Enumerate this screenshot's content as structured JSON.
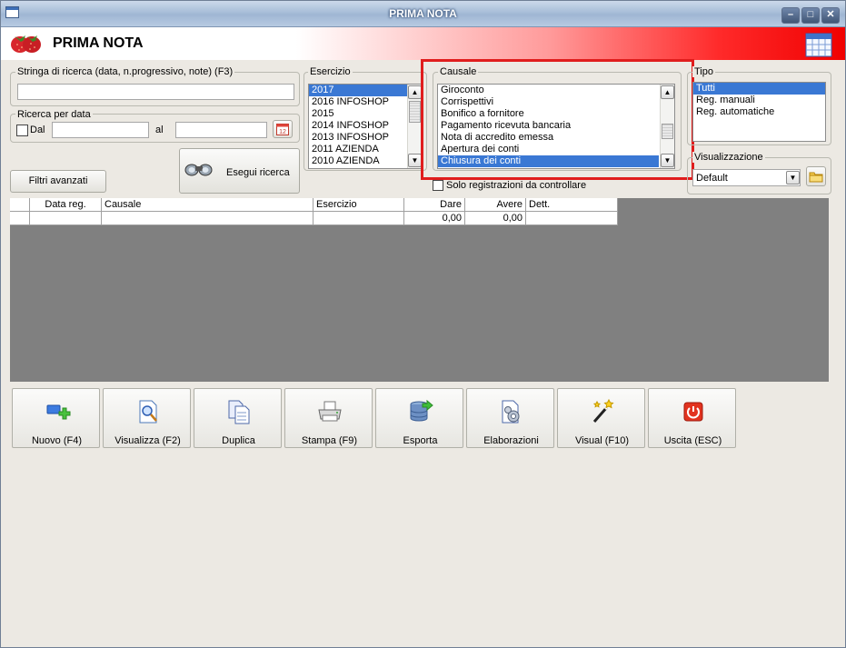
{
  "window": {
    "title": "PRIMA NOTA"
  },
  "header": {
    "title": "PRIMA NOTA"
  },
  "search": {
    "label": "Stringa di ricerca (data, n.progressivo, note) (F3)",
    "value": ""
  },
  "date_search": {
    "label": "Ricerca per data",
    "from_label": "Dal",
    "from_checked": false,
    "from_value": "",
    "to_label": "al",
    "to_value": ""
  },
  "buttons": {
    "advanced_filters": "Filtri avanzati",
    "run_search": "Esegui ricerca"
  },
  "esercizio": {
    "label": "Esercizio",
    "items": [
      "2017",
      "2016 INFOSHOP",
      "2015",
      "2014 INFOSHOP",
      "2013 INFOSHOP",
      "2011 AZIENDA",
      "2010 AZIENDA"
    ],
    "selected": 0
  },
  "causale": {
    "label": "Causale",
    "items": [
      "Giroconto",
      "Corrispettivi",
      "Bonifico a fornitore",
      "Pagamento ricevuta bancaria",
      "Nota di accredito emessa",
      "Apertura dei conti",
      "Chiusura dei conti"
    ],
    "selected": 6
  },
  "to_check": {
    "label": "Solo registrazioni da controllare",
    "checked": false
  },
  "tipo": {
    "label": "Tipo",
    "items": [
      "Tutti",
      "Reg. manuali",
      "Reg. automatiche"
    ],
    "selected": 0
  },
  "visualizzazione": {
    "label": "Visualizzazione",
    "value": "Default"
  },
  "grid": {
    "columns": [
      "Data reg.",
      "Causale",
      "Esercizio",
      "Dare",
      "Avere",
      "Dett."
    ],
    "rows": [
      [
        "",
        "",
        "",
        "0,00",
        "0,00",
        ""
      ]
    ]
  },
  "toolbar": [
    {
      "label": "Nuovo (F4)",
      "icon": "new-icon"
    },
    {
      "label": "Visualizza (F2)",
      "icon": "view-icon"
    },
    {
      "label": "Duplica",
      "icon": "duplicate-icon"
    },
    {
      "label": "Stampa (F9)",
      "icon": "print-icon"
    },
    {
      "label": "Esporta",
      "icon": "export-icon"
    },
    {
      "label": "Elaborazioni",
      "icon": "process-icon"
    },
    {
      "label": "Visual (F10)",
      "icon": "magic-wand-icon"
    },
    {
      "label": "Uscita (ESC)",
      "icon": "exit-icon"
    }
  ],
  "colors": {
    "selection": "#3a78d4",
    "highlight_box": "#e01d1d",
    "grid_background": "#808080"
  }
}
